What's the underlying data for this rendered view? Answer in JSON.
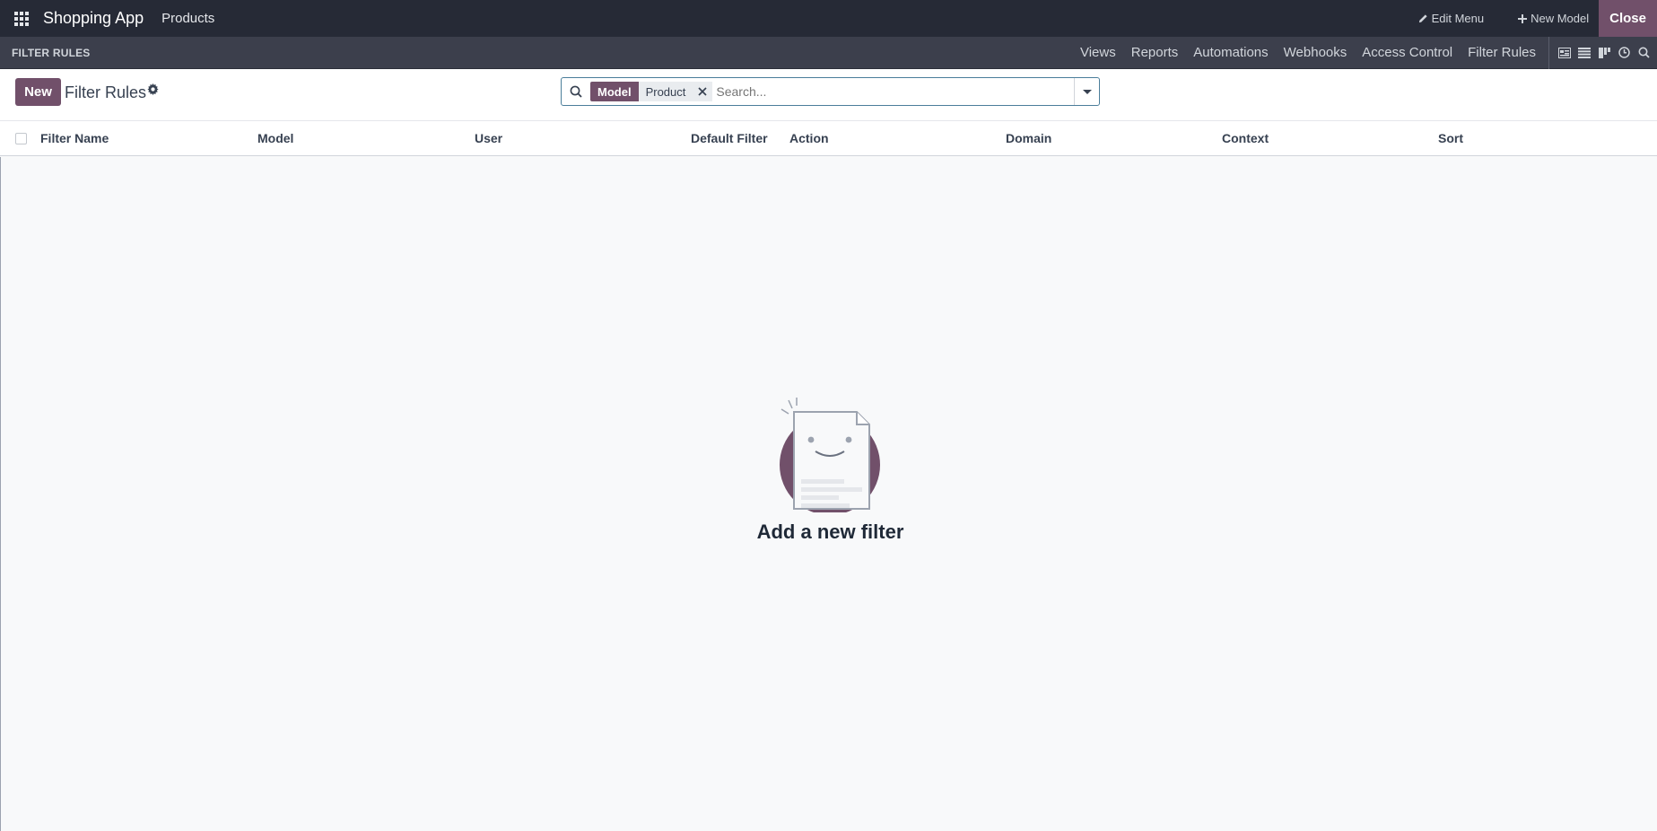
{
  "navbar": {
    "app_name": "Shopping App",
    "menu_item": "Products",
    "edit_menu": "Edit Menu",
    "new_model": "New Model",
    "close": "Close"
  },
  "studio_bar": {
    "title": "FILTER RULES",
    "menu": [
      "Views",
      "Reports",
      "Automations",
      "Webhooks",
      "Access Control",
      "Filter Rules"
    ],
    "view_icons": [
      "form-view-icon",
      "list-view-icon",
      "kanban-view-icon",
      "activity-view-icon",
      "search-view-icon"
    ]
  },
  "control_panel": {
    "new_button": "New",
    "breadcrumb": "Filter Rules",
    "search": {
      "facet_key": "Model",
      "facet_value": "Product",
      "placeholder": "Search..."
    }
  },
  "table": {
    "columns": [
      "Filter Name",
      "Model",
      "User",
      "Default Filter",
      "Action",
      "Domain",
      "Context",
      "Sort"
    ]
  },
  "empty_state": {
    "message": "Add a new filter"
  },
  "colors": {
    "brand": "#71506a",
    "navbar": "#262a36",
    "subbar": "#3c3f4c"
  }
}
